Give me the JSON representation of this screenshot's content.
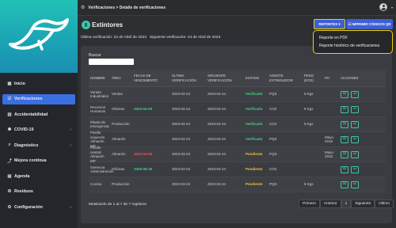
{
  "breadcrumb": "Verificaciones > Detalle de verificaciones",
  "sidebar": {
    "items": [
      {
        "label": "Inicio",
        "icon": "dashboard-icon",
        "glyph": "▦",
        "active": false,
        "chevron": false
      },
      {
        "label": "Verificaciones",
        "icon": "checklist-icon",
        "glyph": "☑",
        "active": true,
        "chevron": false
      },
      {
        "label": "Accidentabilidad",
        "icon": "chart-icon",
        "glyph": "▥",
        "active": false,
        "chevron": false
      },
      {
        "label": "COVID-19",
        "icon": "virus-icon",
        "glyph": "✺",
        "active": false,
        "chevron": true
      },
      {
        "label": "Diagnóstico",
        "icon": "search-icon",
        "glyph": "⌕",
        "active": false,
        "chevron": true
      },
      {
        "label": "Mejora continua",
        "icon": "trend-icon",
        "glyph": "⤴",
        "active": false,
        "chevron": false
      },
      {
        "label": "Agenda",
        "icon": "calendar-icon",
        "glyph": "▤",
        "active": false,
        "chevron": false
      },
      {
        "label": "Residuos",
        "icon": "trash-icon",
        "glyph": "♻",
        "active": false,
        "chevron": false
      },
      {
        "label": "Configuración",
        "icon": "gear-icon",
        "glyph": "⚙",
        "active": false,
        "chevron": true
      }
    ]
  },
  "header": {
    "title": "Extintores",
    "last_verification": "Última verificación: 24 de Abril de 2023",
    "next_verification": "Siguiente verificación: 24 de Abril de 2023"
  },
  "buttons": {
    "reportes": "REPORTES ▾",
    "imprimir": "☷ IMPRIMIR CÓDIGOS QR"
  },
  "dropdown": {
    "items": [
      "Reporte en PDF",
      "Reporte histórico de verificaciones"
    ]
  },
  "search": {
    "label": "Buscar",
    "value": ""
  },
  "table": {
    "headers": [
      "NOMBRE",
      "ÁREA",
      "FECHA DE VENCIMIENTO",
      "ÚLTIMA VERIFICACIÓN",
      "SIGUIENTE VERIFICACIÓN",
      "ESTADO",
      "AGENTE EXTINGUIDOR",
      "PESO (KGS)",
      "PH",
      "ACCIONES"
    ],
    "rows": [
      {
        "nombre": "Ventas Industriales",
        "area": "Ventas",
        "vencimiento": "",
        "venc_color": "",
        "ultima": "2023-04-24",
        "siguiente": "2023-04-24",
        "estado": "Verificado",
        "agente": "PQS",
        "peso": "9 Kgs",
        "ph": ""
      },
      {
        "nombre": "Recursos Humanos",
        "area": "Oficinas",
        "vencimiento": "2024-04-09",
        "venc_color": "green",
        "ultima": "2023-04-24",
        "siguiente": "2023-04-24",
        "estado": "Verificado",
        "agente": "CO2",
        "peso": "9 Kgs",
        "ph": ""
      },
      {
        "nombre": "Planta de emergencia",
        "area": "Producción",
        "vencimiento": "",
        "venc_color": "",
        "ultima": "2023-04-24",
        "siguiente": "2023-04-24",
        "estado": "Verificado",
        "agente": "CO2",
        "peso": "9 Kgs",
        "ph": ""
      },
      {
        "nombre": "Pasillo izquierdo Almacén MP",
        "area": "Almacén",
        "vencimiento": "",
        "venc_color": "",
        "ultima": "2023-04-24",
        "siguiente": "2023-04-24",
        "estado": "Verificado",
        "agente": "PQS",
        "peso": "",
        "ph": "Mayo 2015"
      },
      {
        "nombre": "Pasillo central Almacén MP",
        "area": "Almacén",
        "vencimiento": "2023-04-05",
        "venc_color": "red",
        "ultima": "2023-03-23",
        "siguiente": "2023-04-24",
        "estado": "Pendiente",
        "agente": "PQS",
        "peso": "",
        "ph": "Mayo 2015"
      },
      {
        "nombre": "Gerencia Administración",
        "area": "Oficinas",
        "vencimiento": "2025-06-16",
        "venc_color": "green",
        "ultima": "2023-03-23",
        "siguiente": "2023-04-24",
        "estado": "Pendiente",
        "agente": "CO2",
        "peso": "",
        "ph": ""
      },
      {
        "nombre": "Cocina",
        "area": "Producción",
        "vencimiento": "",
        "venc_color": "",
        "ultima": "2023-03-23",
        "siguiente": "2023-04-24",
        "estado": "Pendiente",
        "agente": "PQS",
        "peso": "9 Kgs",
        "ph": ""
      }
    ]
  },
  "footer": {
    "showing": "Mostrando de 1 al 7 de 7 registros",
    "pager": [
      "Primero",
      "Anterior",
      "1",
      "Siguiente",
      "Último"
    ]
  }
}
